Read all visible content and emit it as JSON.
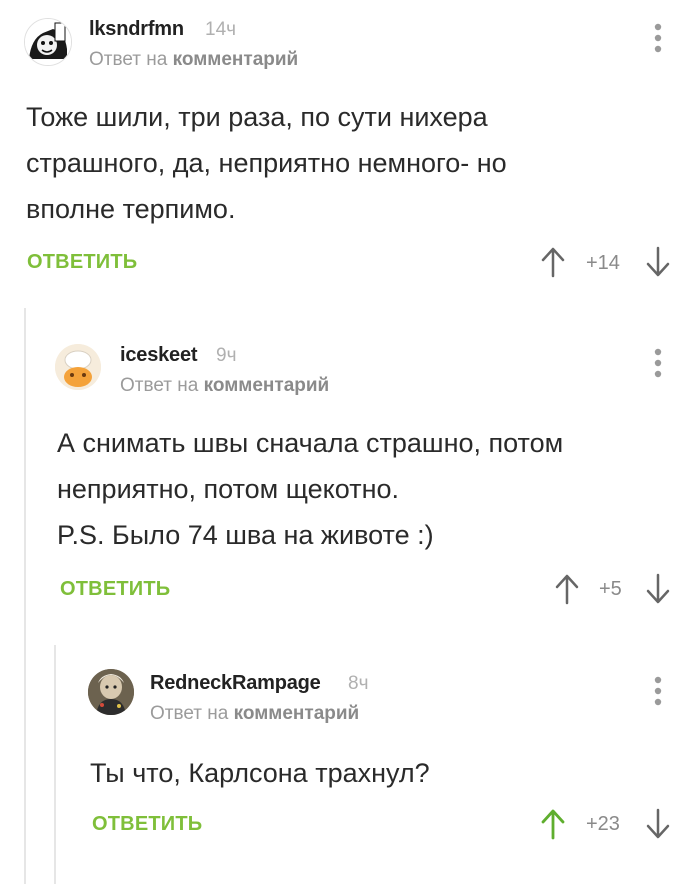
{
  "comments": [
    {
      "username": "lksndrfmn",
      "time": "14ч",
      "reply_prefix": "Ответ на",
      "reply_link": "комментарий",
      "text": "Тоже шили, три раза, по сути нихера\nстрашного, да, неприятно немного- но\nвполне терпимо.",
      "reply_label": "ОТВЕТИТЬ",
      "rating": "+14"
    },
    {
      "username": "iceskeet",
      "time": "9ч",
      "reply_prefix": "Ответ на",
      "reply_link": "комментарий",
      "text": "А снимать швы сначала страшно, потом\nнеприятно, потом щекотно.\nP.S. Было 74 шва на животе :)",
      "reply_label": "ОТВЕТИТЬ",
      "rating": "+5"
    },
    {
      "username": "RedneckRampage",
      "time": "8ч",
      "reply_prefix": "Ответ на",
      "reply_link": "комментарий",
      "text": "Ты что, Карлсона трахнул?",
      "reply_label": "ОТВЕТИТЬ",
      "rating": "+23"
    }
  ],
  "colors": {
    "accent": "#7fbf3a",
    "muted": "#9b9b9b",
    "thread_line": "#e6e6e6",
    "upvoted": "#5fae2e"
  },
  "icons": [
    "avatar",
    "upvote-arrow-icon",
    "downvote-arrow-icon",
    "more-vertical-icon"
  ]
}
